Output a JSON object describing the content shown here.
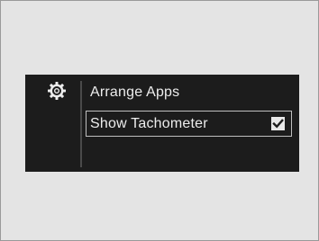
{
  "menu": {
    "icon": "gear-icon",
    "items": [
      {
        "label": "Arrange Apps"
      },
      {
        "label": "Show Tachometer",
        "checked": true
      }
    ]
  },
  "colors": {
    "screen_background": "#1c1c1c",
    "text": "#ededed",
    "page_background": "#e4e4e4"
  }
}
